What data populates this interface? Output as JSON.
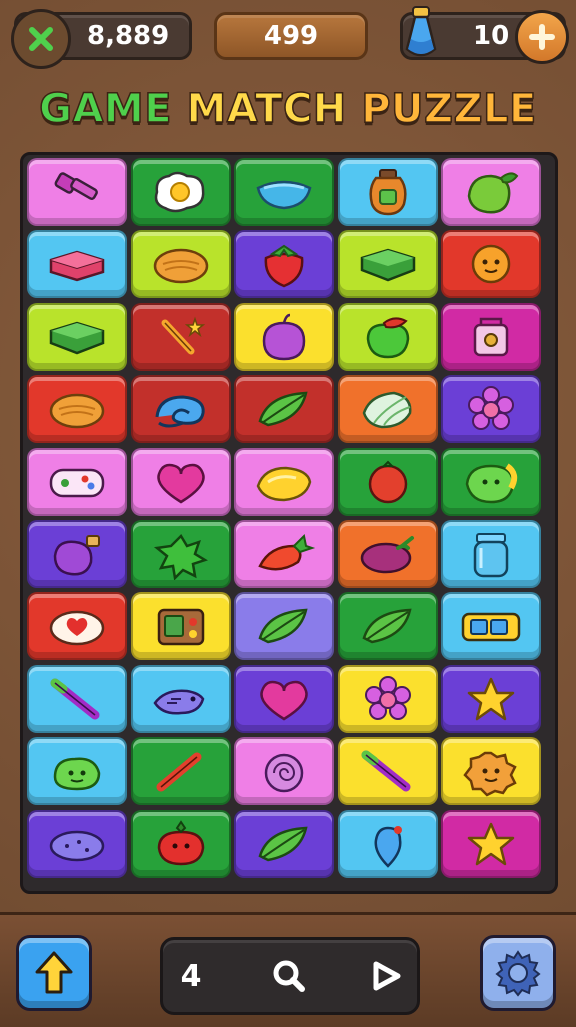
{
  "hud": {
    "coins": "8,889",
    "score": "499",
    "boosters": "10",
    "icons": [
      "close-x-icon",
      "potion-icon",
      "plus-icon"
    ]
  },
  "title": {
    "word1": "GAME",
    "word2": "MATCH",
    "word3": "PUZZLE"
  },
  "colors": {
    "pink": "#ef7fe6",
    "green": "#27a23a",
    "cyan": "#53c6f2",
    "lime": "#b9e32b",
    "red": "#e2382b",
    "darkred": "#c2302b",
    "yellow": "#fbe02d",
    "purple": "#6b3fd6",
    "orange": "#f0712b",
    "magenta": "#d12aa4",
    "violet": "#8a7cea"
  },
  "board": {
    "rows": [
      [
        {
          "bg": "pink",
          "item": "hammer"
        },
        {
          "bg": "green",
          "item": "egg"
        },
        {
          "bg": "green",
          "item": "bowl"
        },
        {
          "bg": "cyan",
          "item": "jar"
        },
        {
          "bg": "pink",
          "item": "leaf-fruit"
        }
      ],
      [
        {
          "bg": "cyan",
          "item": "gift-box"
        },
        {
          "bg": "lime",
          "item": "bread"
        },
        {
          "bg": "purple",
          "item": "strawberry"
        },
        {
          "bg": "lime",
          "item": "green-box"
        },
        {
          "bg": "red",
          "item": "orange-face"
        }
      ],
      [
        {
          "bg": "lime",
          "item": "green-box"
        },
        {
          "bg": "darkred",
          "item": "wand"
        },
        {
          "bg": "yellow",
          "item": "plum"
        },
        {
          "bg": "lime",
          "item": "apple"
        },
        {
          "bg": "magenta",
          "item": "lock"
        }
      ],
      [
        {
          "bg": "red",
          "item": "bread"
        },
        {
          "bg": "darkred",
          "item": "swirl"
        },
        {
          "bg": "darkred",
          "item": "leaf"
        },
        {
          "bg": "orange",
          "item": "cabbage"
        },
        {
          "bg": "purple",
          "item": "flower"
        }
      ],
      [
        {
          "bg": "pink",
          "item": "gamepad"
        },
        {
          "bg": "pink",
          "item": "heart"
        },
        {
          "bg": "pink",
          "item": "lemon"
        },
        {
          "bg": "green",
          "item": "tomato"
        },
        {
          "bg": "green",
          "item": "lime-face"
        }
      ],
      [
        {
          "bg": "purple",
          "item": "bottle"
        },
        {
          "bg": "green",
          "item": "splat"
        },
        {
          "bg": "pink",
          "item": "carrot"
        },
        {
          "bg": "orange",
          "item": "eggplant"
        },
        {
          "bg": "cyan",
          "item": "glass-jar"
        }
      ],
      [
        {
          "bg": "red",
          "item": "heart-plate"
        },
        {
          "bg": "yellow",
          "item": "radio"
        },
        {
          "bg": "violet",
          "item": "leaf"
        },
        {
          "bg": "green",
          "item": "leaf"
        },
        {
          "bg": "cyan",
          "item": "ticket"
        }
      ],
      [
        {
          "bg": "cyan",
          "item": "crayon"
        },
        {
          "bg": "cyan",
          "item": "fish"
        },
        {
          "bg": "purple",
          "item": "heart"
        },
        {
          "bg": "yellow",
          "item": "flower"
        },
        {
          "bg": "purple",
          "item": "star"
        }
      ],
      [
        {
          "bg": "cyan",
          "item": "slime"
        },
        {
          "bg": "green",
          "item": "bat"
        },
        {
          "bg": "pink",
          "item": "candy"
        },
        {
          "bg": "yellow",
          "item": "crayon"
        },
        {
          "bg": "yellow",
          "item": "cookie"
        }
      ],
      [
        {
          "bg": "purple",
          "item": "bean"
        },
        {
          "bg": "green",
          "item": "tomato-face"
        },
        {
          "bg": "purple",
          "item": "leaf"
        },
        {
          "bg": "cyan",
          "item": "balloon"
        },
        {
          "bg": "magenta",
          "item": "star"
        }
      ]
    ]
  },
  "controls": {
    "up_icon": "arrow-up-icon",
    "moves": "4",
    "settings_icon": "gear-icon"
  }
}
